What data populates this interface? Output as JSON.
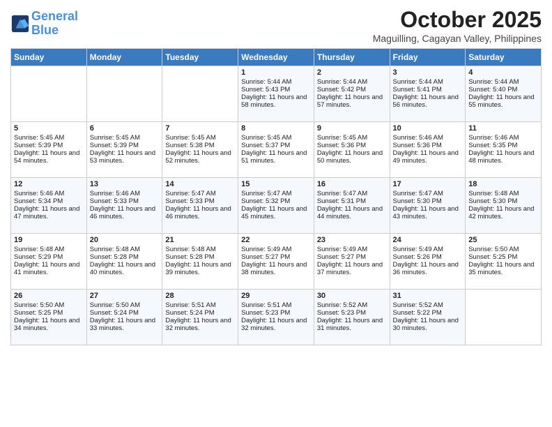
{
  "logo": {
    "line1": "General",
    "line2": "Blue"
  },
  "header": {
    "month": "October 2025",
    "location": "Maguilling, Cagayan Valley, Philippines"
  },
  "days_of_week": [
    "Sunday",
    "Monday",
    "Tuesday",
    "Wednesday",
    "Thursday",
    "Friday",
    "Saturday"
  ],
  "weeks": [
    [
      {
        "day": "",
        "sunrise": "",
        "sunset": "",
        "daylight": ""
      },
      {
        "day": "",
        "sunrise": "",
        "sunset": "",
        "daylight": ""
      },
      {
        "day": "",
        "sunrise": "",
        "sunset": "",
        "daylight": ""
      },
      {
        "day": "1",
        "sunrise": "Sunrise: 5:44 AM",
        "sunset": "Sunset: 5:43 PM",
        "daylight": "Daylight: 11 hours and 58 minutes."
      },
      {
        "day": "2",
        "sunrise": "Sunrise: 5:44 AM",
        "sunset": "Sunset: 5:42 PM",
        "daylight": "Daylight: 11 hours and 57 minutes."
      },
      {
        "day": "3",
        "sunrise": "Sunrise: 5:44 AM",
        "sunset": "Sunset: 5:41 PM",
        "daylight": "Daylight: 11 hours and 56 minutes."
      },
      {
        "day": "4",
        "sunrise": "Sunrise: 5:44 AM",
        "sunset": "Sunset: 5:40 PM",
        "daylight": "Daylight: 11 hours and 55 minutes."
      }
    ],
    [
      {
        "day": "5",
        "sunrise": "Sunrise: 5:45 AM",
        "sunset": "Sunset: 5:39 PM",
        "daylight": "Daylight: 11 hours and 54 minutes."
      },
      {
        "day": "6",
        "sunrise": "Sunrise: 5:45 AM",
        "sunset": "Sunset: 5:39 PM",
        "daylight": "Daylight: 11 hours and 53 minutes."
      },
      {
        "day": "7",
        "sunrise": "Sunrise: 5:45 AM",
        "sunset": "Sunset: 5:38 PM",
        "daylight": "Daylight: 11 hours and 52 minutes."
      },
      {
        "day": "8",
        "sunrise": "Sunrise: 5:45 AM",
        "sunset": "Sunset: 5:37 PM",
        "daylight": "Daylight: 11 hours and 51 minutes."
      },
      {
        "day": "9",
        "sunrise": "Sunrise: 5:45 AM",
        "sunset": "Sunset: 5:36 PM",
        "daylight": "Daylight: 11 hours and 50 minutes."
      },
      {
        "day": "10",
        "sunrise": "Sunrise: 5:46 AM",
        "sunset": "Sunset: 5:36 PM",
        "daylight": "Daylight: 11 hours and 49 minutes."
      },
      {
        "day": "11",
        "sunrise": "Sunrise: 5:46 AM",
        "sunset": "Sunset: 5:35 PM",
        "daylight": "Daylight: 11 hours and 48 minutes."
      }
    ],
    [
      {
        "day": "12",
        "sunrise": "Sunrise: 5:46 AM",
        "sunset": "Sunset: 5:34 PM",
        "daylight": "Daylight: 11 hours and 47 minutes."
      },
      {
        "day": "13",
        "sunrise": "Sunrise: 5:46 AM",
        "sunset": "Sunset: 5:33 PM",
        "daylight": "Daylight: 11 hours and 46 minutes."
      },
      {
        "day": "14",
        "sunrise": "Sunrise: 5:47 AM",
        "sunset": "Sunset: 5:33 PM",
        "daylight": "Daylight: 11 hours and 46 minutes."
      },
      {
        "day": "15",
        "sunrise": "Sunrise: 5:47 AM",
        "sunset": "Sunset: 5:32 PM",
        "daylight": "Daylight: 11 hours and 45 minutes."
      },
      {
        "day": "16",
        "sunrise": "Sunrise: 5:47 AM",
        "sunset": "Sunset: 5:31 PM",
        "daylight": "Daylight: 11 hours and 44 minutes."
      },
      {
        "day": "17",
        "sunrise": "Sunrise: 5:47 AM",
        "sunset": "Sunset: 5:30 PM",
        "daylight": "Daylight: 11 hours and 43 minutes."
      },
      {
        "day": "18",
        "sunrise": "Sunrise: 5:48 AM",
        "sunset": "Sunset: 5:30 PM",
        "daylight": "Daylight: 11 hours and 42 minutes."
      }
    ],
    [
      {
        "day": "19",
        "sunrise": "Sunrise: 5:48 AM",
        "sunset": "Sunset: 5:29 PM",
        "daylight": "Daylight: 11 hours and 41 minutes."
      },
      {
        "day": "20",
        "sunrise": "Sunrise: 5:48 AM",
        "sunset": "Sunset: 5:28 PM",
        "daylight": "Daylight: 11 hours and 40 minutes."
      },
      {
        "day": "21",
        "sunrise": "Sunrise: 5:48 AM",
        "sunset": "Sunset: 5:28 PM",
        "daylight": "Daylight: 11 hours and 39 minutes."
      },
      {
        "day": "22",
        "sunrise": "Sunrise: 5:49 AM",
        "sunset": "Sunset: 5:27 PM",
        "daylight": "Daylight: 11 hours and 38 minutes."
      },
      {
        "day": "23",
        "sunrise": "Sunrise: 5:49 AM",
        "sunset": "Sunset: 5:27 PM",
        "daylight": "Daylight: 11 hours and 37 minutes."
      },
      {
        "day": "24",
        "sunrise": "Sunrise: 5:49 AM",
        "sunset": "Sunset: 5:26 PM",
        "daylight": "Daylight: 11 hours and 36 minutes."
      },
      {
        "day": "25",
        "sunrise": "Sunrise: 5:50 AM",
        "sunset": "Sunset: 5:25 PM",
        "daylight": "Daylight: 11 hours and 35 minutes."
      }
    ],
    [
      {
        "day": "26",
        "sunrise": "Sunrise: 5:50 AM",
        "sunset": "Sunset: 5:25 PM",
        "daylight": "Daylight: 11 hours and 34 minutes."
      },
      {
        "day": "27",
        "sunrise": "Sunrise: 5:50 AM",
        "sunset": "Sunset: 5:24 PM",
        "daylight": "Daylight: 11 hours and 33 minutes."
      },
      {
        "day": "28",
        "sunrise": "Sunrise: 5:51 AM",
        "sunset": "Sunset: 5:24 PM",
        "daylight": "Daylight: 11 hours and 32 minutes."
      },
      {
        "day": "29",
        "sunrise": "Sunrise: 5:51 AM",
        "sunset": "Sunset: 5:23 PM",
        "daylight": "Daylight: 11 hours and 32 minutes."
      },
      {
        "day": "30",
        "sunrise": "Sunrise: 5:52 AM",
        "sunset": "Sunset: 5:23 PM",
        "daylight": "Daylight: 11 hours and 31 minutes."
      },
      {
        "day": "31",
        "sunrise": "Sunrise: 5:52 AM",
        "sunset": "Sunset: 5:22 PM",
        "daylight": "Daylight: 11 hours and 30 minutes."
      },
      {
        "day": "",
        "sunrise": "",
        "sunset": "",
        "daylight": ""
      }
    ]
  ]
}
